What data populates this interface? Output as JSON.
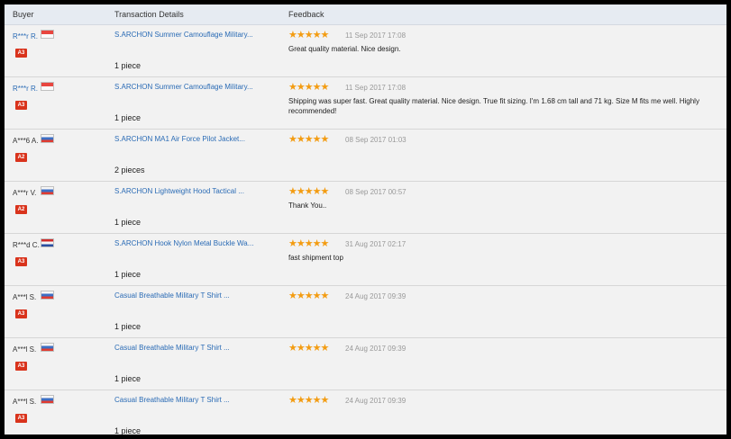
{
  "header": {
    "buyer": "Buyer",
    "details": "Transaction Details",
    "feedback": "Feedback"
  },
  "colors": {
    "link": "#2a6bb5",
    "star": "#f39c12",
    "badge": "#d9331c",
    "header_bg": "#e6ebf2"
  },
  "rows": [
    {
      "buyer": "R***r R.",
      "flag": "singapore-flag",
      "level": "A3",
      "product": "S.ARCHON Summer Camouflage Military...",
      "qty": "1 piece",
      "stars": 5,
      "date": "11 Sep 2017 17:08",
      "feedback": "Great quality material. Nice design."
    },
    {
      "buyer": "R***r R.",
      "flag": "singapore-flag",
      "level": "A3",
      "product": "S.ARCHON Summer Camouflage Military...",
      "qty": "1 piece",
      "stars": 5,
      "date": "11 Sep 2017 17:08",
      "feedback": "Shipping was super fast. Great quality material. Nice design. True fit sizing. I'm 1.68 cm tall and 71 kg. Size M fits me well. Highly recommended!"
    },
    {
      "buyer": "A***6 A.",
      "flag": "russia-flag",
      "level": "A2",
      "product": "S.ARCHON MA1 Air Force Pilot Jacket...",
      "qty": "2 pieces",
      "stars": 5,
      "date": "08 Sep 2017 01:03",
      "feedback": ""
    },
    {
      "buyer": "A***r V.",
      "flag": "russia-flag",
      "level": "A2",
      "product": "S.ARCHON Lightweight Hood Tactical ...",
      "qty": "1 piece",
      "stars": 5,
      "date": "08 Sep 2017 00:57",
      "feedback": "Thank You.."
    },
    {
      "buyer": "R***d C.",
      "flag": "netherlands-flag",
      "level": "A3",
      "product": "S.ARCHON Hook Nylon Metal Buckle Wa...",
      "qty": "1 piece",
      "stars": 5,
      "date": "31 Aug 2017 02:17",
      "feedback": "fast shipment top"
    },
    {
      "buyer": "A***l S.",
      "flag": "russia-flag",
      "level": "A3",
      "product": "Casual Breathable Military T Shirt ...",
      "qty": "1 piece",
      "stars": 5,
      "date": "24 Aug 2017 09:39",
      "feedback": ""
    },
    {
      "buyer": "A***l S.",
      "flag": "russia-flag",
      "level": "A3",
      "product": "Casual Breathable Military T Shirt ...",
      "qty": "1 piece",
      "stars": 5,
      "date": "24 Aug 2017 09:39",
      "feedback": ""
    },
    {
      "buyer": "A***l S.",
      "flag": "russia-flag",
      "level": "A3",
      "product": "Casual Breathable Military T Shirt ...",
      "qty": "1 piece",
      "stars": 5,
      "date": "24 Aug 2017 09:39",
      "feedback": ""
    }
  ]
}
